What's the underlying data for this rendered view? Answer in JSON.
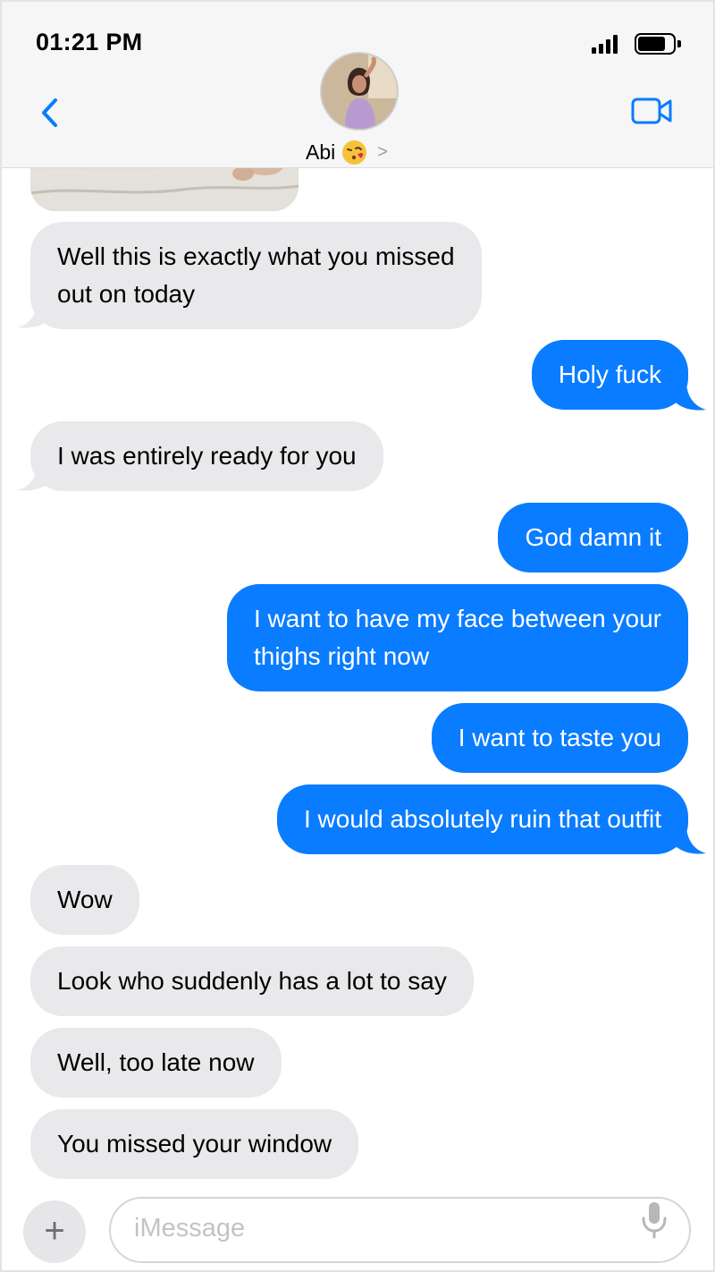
{
  "status_bar": {
    "time": "01:21 PM",
    "signal_icon": "cellular-signal-icon",
    "battery_icon": "battery-icon"
  },
  "header": {
    "back_icon": "chevron-left-icon",
    "contact_name": "Abi",
    "contact_emoji": "face-blowing-kiss-emoji",
    "chevron": ">",
    "video_icon": "video-camera-icon"
  },
  "messages": [
    {
      "direction": "incoming",
      "text": "Well this is exactly what you missed\nout on today"
    },
    {
      "direction": "outgoing",
      "text": "Holy fuck"
    },
    {
      "direction": "incoming",
      "text": "I was entirely ready for you"
    },
    {
      "direction": "outgoing",
      "text": "God damn it"
    },
    {
      "direction": "outgoing",
      "text": "I want to have my face between your\nthighs right now"
    },
    {
      "direction": "outgoing",
      "text": "I want to taste you"
    },
    {
      "direction": "outgoing",
      "text": "I would absolutely ruin that outfit"
    },
    {
      "direction": "incoming",
      "text": "Wow"
    },
    {
      "direction": "incoming",
      "text": "Look who suddenly has a lot to say"
    },
    {
      "direction": "incoming",
      "text": "Well, too late now"
    },
    {
      "direction": "incoming",
      "text": "You missed your window"
    }
  ],
  "composer": {
    "plus_label": "+",
    "placeholder": "iMessage",
    "mic_icon": "microphone-icon"
  },
  "colors": {
    "outgoing_bubble": "#0a7cff",
    "incoming_bubble": "#e9e9eb",
    "accent": "#0a7cff",
    "header_bg": "#f6f6f6"
  }
}
